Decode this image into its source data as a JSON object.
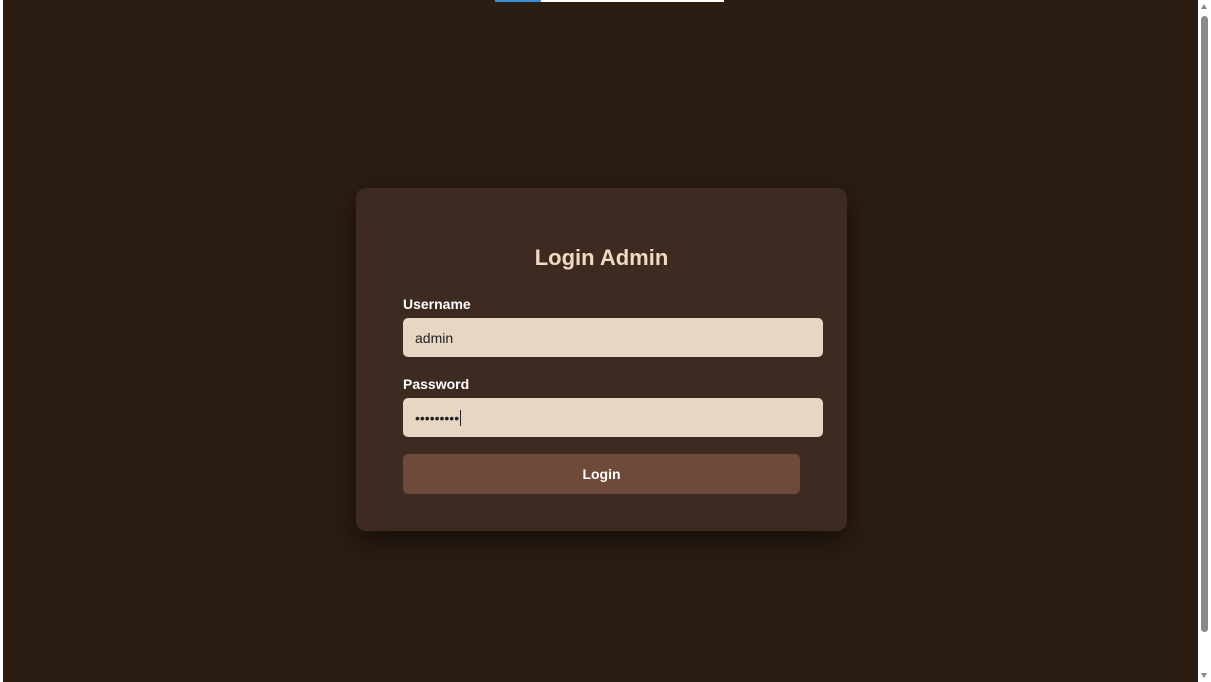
{
  "colors": {
    "background": "#2b1d12",
    "card": "#3d2a20",
    "title": "#f2d9bf",
    "input_bg": "#e8d6c4",
    "button": "#6e4a3b"
  },
  "login": {
    "title": "Login Admin",
    "username_label": "Username",
    "username_value": "admin",
    "password_label": "Password",
    "password_value": "•••••••••",
    "button_label": "Login"
  }
}
